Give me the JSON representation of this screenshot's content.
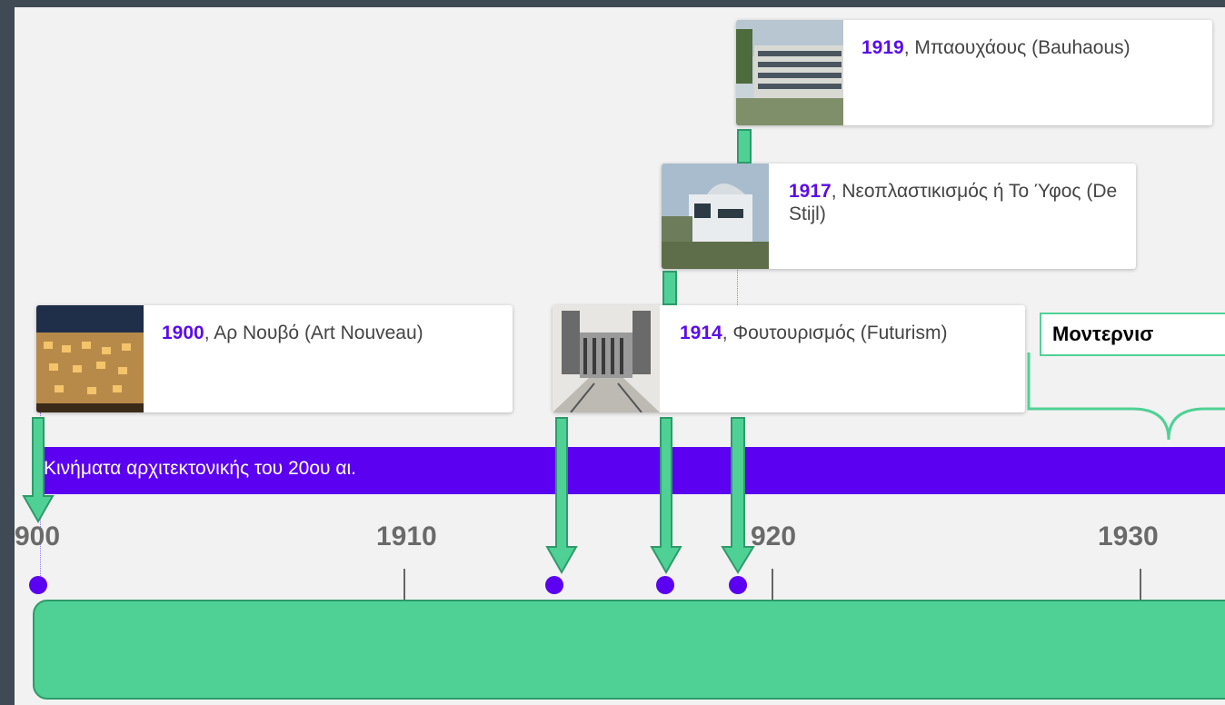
{
  "timeline": {
    "band_title": "Κινήματα αρχιτεκτονικής του 20ου αι.",
    "ticks": [
      "900",
      "1910",
      "920",
      "1930"
    ],
    "events": [
      {
        "year": "1900",
        "label": ", Αρ Νουβό (Art Nouveau)"
      },
      {
        "year": "1914",
        "label": ", Φουτουρισμός (Futurism)"
      },
      {
        "year": "1917",
        "label": ", Νεοπλαστικισμός ή Το Ύφος (De Stijl)"
      },
      {
        "year": "1919",
        "label": ", Μπαουχάους (Bauhaous)"
      }
    ],
    "modernism_label": "Μοντερνισ"
  },
  "colors": {
    "band": "#5b00f0",
    "year_text": "#5b0ce8",
    "arrow_fill": "#4fd195",
    "arrow_stroke": "#2e9a6a"
  }
}
